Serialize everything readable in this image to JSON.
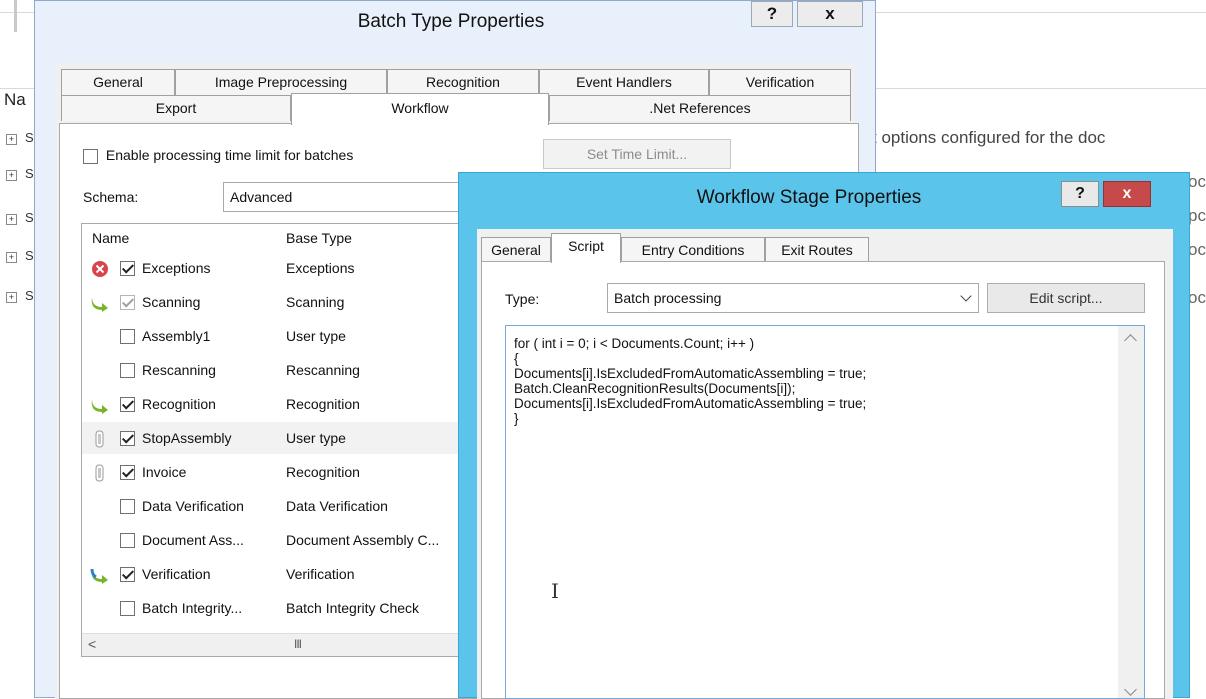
{
  "background": {
    "column_header": "Na",
    "tree_rows": [
      "S",
      "S",
      "S",
      "S",
      "S"
    ],
    "right_text": "t options configured for the doc",
    "right_fragments": [
      "oc",
      "pc",
      "oc",
      "pc",
      "oc"
    ]
  },
  "batch_dialog": {
    "title": "Batch Type Properties",
    "help_label": "?",
    "close_label": "x",
    "tabs_row1": [
      "General",
      "Image Preprocessing",
      "Recognition",
      "Event Handlers",
      "Verification"
    ],
    "tabs_row2": [
      "Export",
      "Workflow",
      ".Net References"
    ],
    "active_tab": "Workflow",
    "time_limit_label": "Enable processing time limit for batches",
    "time_limit_checked": false,
    "set_time_limit_label": "Set Time Limit...",
    "schema_label": "Schema:",
    "schema_value": "Advanced",
    "list_headers": {
      "name": "Name",
      "base_type": "Base Type"
    },
    "stages": [
      {
        "name": "Exceptions",
        "base_type": "Exceptions",
        "checked": true,
        "icon": "error-icon"
      },
      {
        "name": "Scanning",
        "base_type": "Scanning",
        "checked": true,
        "disabled": true,
        "icon": "green-arrow-icon"
      },
      {
        "name": "Assembly1",
        "base_type": "User type",
        "checked": false,
        "icon": ""
      },
      {
        "name": "Rescanning",
        "base_type": "Rescanning",
        "checked": false,
        "icon": ""
      },
      {
        "name": "Recognition",
        "base_type": "Recognition",
        "checked": true,
        "icon": "green-arrow-icon"
      },
      {
        "name": "StopAssembly",
        "base_type": "User type",
        "checked": true,
        "icon": "pause-icon",
        "selected": true
      },
      {
        "name": "Invoice",
        "base_type": "Recognition",
        "checked": true,
        "icon": "pause-icon"
      },
      {
        "name": "Data Verification",
        "base_type": "Data Verification",
        "checked": false,
        "icon": ""
      },
      {
        "name": "Document Ass...",
        "base_type": "Document Assembly C...",
        "checked": false,
        "icon": ""
      },
      {
        "name": "Verification",
        "base_type": "Verification",
        "checked": true,
        "icon": "blue-green-arrow-icon"
      },
      {
        "name": "Batch Integrity...",
        "base_type": "Batch Integrity Check",
        "checked": false,
        "icon": ""
      }
    ],
    "scroll_left": "<",
    "scroll_thumb": "III"
  },
  "stage_dialog": {
    "title": "Workflow Stage Properties",
    "help_label": "?",
    "close_label": "x",
    "tabs": [
      "General",
      "Script",
      "Entry Conditions",
      "Exit Routes"
    ],
    "active_tab": "Script",
    "type_label": "Type:",
    "type_value": "Batch processing",
    "edit_script_label": "Edit script...",
    "script_lines": [
      "for ( int i = 0; i < Documents.Count; i++ )",
      "{",
      "Documents[i].IsExcludedFromAutomaticAssembling = true;",
      "Batch.CleanRecognitionResults(Documents[i]);",
      "Documents[i].IsExcludedFromAutomaticAssembling = true;",
      "}"
    ]
  },
  "colors": {
    "stage_dialog_frame": "#5bc4ea",
    "batch_dialog_frame": "#e8f1fb",
    "close_button": "#c74a4a"
  }
}
